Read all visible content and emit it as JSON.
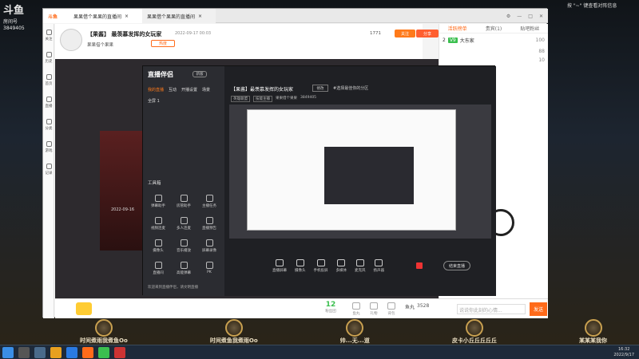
{
  "top": {
    "logo_title": "斗鱼",
    "room_label": "房间号",
    "room_num": "3849405",
    "right_text": "按 \"~\" 键查看对阵信息"
  },
  "tabs": [
    {
      "label": "果果借个果果的直播间"
    },
    {
      "label": "果果借个果果的直播间"
    }
  ],
  "room": {
    "title": "【果酱】 最羡慕发挥的女玩家",
    "date": "2022-09-17 00:03",
    "anchor": "果果借个果果",
    "follow_label": "关注",
    "share_label": "分享",
    "count": "1771",
    "tag_hot": "热度",
    "tag_report": "直播公告"
  },
  "rightpanel": {
    "tabs": [
      "活跃榜单",
      "贵宾(1)",
      "贴吧粉丝"
    ],
    "rank_label": "2",
    "rank_badge": "V9",
    "rank_name": "大东家",
    "lines": [
      "请不要的直播间，",
      "禁止传播封",
      "，封号处理，",
      "违规处理。",
      "有严格封禁主播",
      "注意言行文明，",
      "营造良好",
      "环境直播",
      "来到本直播间"
    ],
    "gift_num_a": "100",
    "gift_num_b": "88",
    "gift_num_c": "10"
  },
  "companion": {
    "app_name": "直播伴侣",
    "version": "新版",
    "menu": [
      "我的直播",
      "互动",
      "开播设置",
      "场景"
    ],
    "scene_label": "全屏 1",
    "tools_header": "工具箱",
    "tools": [
      "弹幕助手",
      "房管助手",
      "主播任务",
      "视频连麦",
      "多人连麦",
      "直播预告",
      "摄像头",
      "音乐播放",
      "屏幕录像",
      "直播间",
      "高能弹幕",
      "PK"
    ],
    "title": "【果酱】最羡慕发挥的女玩家",
    "edit_label": "修改",
    "tag": "#选择最佳你的分区",
    "cat1": "英雄联盟",
    "cat2": "技能主播",
    "anchor": "果果借个果果",
    "room_num": "3849405",
    "controls": [
      "直播屏幕",
      "摄像头",
      "手机投屏",
      "多媒体",
      "麦克风",
      "扬声器"
    ],
    "start_label": "结束直播",
    "status": "直播中",
    "notice": "欢迎来到直播伴侣，请文明直播",
    "bottom_room": "房间 3849405 2022.09.17",
    "bottom_overlay": "2022-09-16"
  },
  "bottom": {
    "fish_label": "鱼丸",
    "fish_val": "3528",
    "badge_val": "12",
    "badge_sub": "粉丝团",
    "chat_placeholder": "说说你此刻的心情...",
    "send_label": "发送",
    "gift_labels": [
      "鱼丸",
      "礼物",
      "背包"
    ]
  },
  "players": [
    {
      "name": "时间煮雨我煮鱼Oo"
    },
    {
      "name": "时间煮鱼我煮雨Oo"
    },
    {
      "name": "帅...无...道"
    },
    {
      "name": "皮卡小丘丘丘丘丘"
    },
    {
      "name": "某某某我你"
    }
  ],
  "taskbar": {
    "time": "16:32",
    "date": "2022/9/17"
  },
  "colors": {
    "orange": "#ff6b1a",
    "douyu_orange": "#ff7a1a",
    "green": "#3bbf4f"
  }
}
